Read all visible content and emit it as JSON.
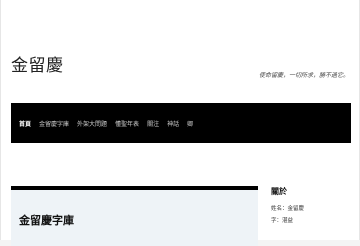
{
  "site": {
    "title": "金留慶",
    "tagline": "使命留慶，一切所求，勝不過它。"
  },
  "nav": {
    "items": [
      {
        "label": "首頁",
        "active": true
      },
      {
        "label": "金留慶字庫",
        "active": false
      },
      {
        "label": "外架大問題",
        "active": false
      },
      {
        "label": "懂聖年表",
        "active": false
      },
      {
        "label": "關注",
        "active": false
      },
      {
        "label": "神話",
        "active": false
      },
      {
        "label": "卿",
        "active": false
      }
    ]
  },
  "main": {
    "card_title": "金留慶字庫"
  },
  "sidebar": {
    "heading": "關於",
    "lines": [
      "姓名：金留慶",
      "字：湛益"
    ]
  }
}
